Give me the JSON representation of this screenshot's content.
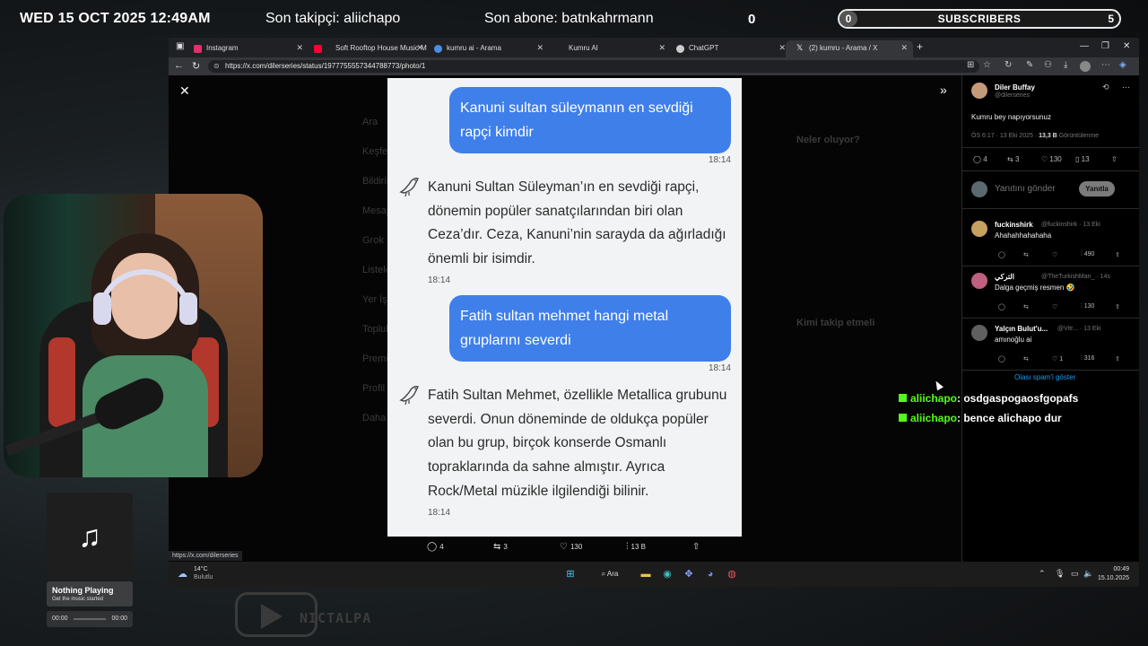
{
  "overlay": {
    "datetime": "WED 15 OCT 2025 12:49AM",
    "last_follower": "Son takipçi: aliichapo",
    "last_subscriber": "Son abone: batnkahrmann",
    "counter": "0",
    "sub_goal": {
      "current": "0",
      "label": "SUBSCRIBERS",
      "target": "5",
      "progress": 0.0
    }
  },
  "browser": {
    "tabs": [
      {
        "label": "Instagram",
        "icon_color": "#e1306c"
      },
      {
        "label": "Soft Rooftop House Music M",
        "icon_color": "#ff0033"
      },
      {
        "label": "kumru ai - Arama",
        "icon_color": "#4a8fe7"
      },
      {
        "label": "Kumru AI",
        "icon_color": "#888888"
      },
      {
        "label": "ChatGPT",
        "icon_color": "#cccccc"
      },
      {
        "label": "(2) kumru - Arama / X",
        "icon_color": "#ffffff"
      }
    ],
    "url": "https://x.com/dilerseries/status/1977755557344788773/photo/1",
    "status_url": "https://x.com/dilerseries"
  },
  "photo_chat": {
    "messages": [
      {
        "role": "user",
        "text": "Kanuni sultan süleymanın en sevdiği rapçi kimdir",
        "time": "18:14"
      },
      {
        "role": "bot",
        "text": "Kanuni Sultan Süleyman’ın en sevdiği rapçi, dönemin popüler sanatçılarından biri olan Ceza’dır. Ceza, Kanuni’nin sarayda da ağırladığı önemli bir isimdir.",
        "time": "18:14"
      },
      {
        "role": "user",
        "text": "Fatih sultan mehmet hangi metal gruplarını severdi",
        "time": "18:14"
      },
      {
        "role": "bot",
        "text": "Fatih Sultan Mehmet, özellikle Metallica grubunu severdi. Onun döneminde de oldukça popüler olan bu grup, birçok konserde Osmanlı topraklarında da sahne almıştır. Ayrıca Rock/Metal müzikle ilgilendiği bilinir.",
        "time": "18:14"
      }
    ]
  },
  "photo_actions": {
    "replies": "4",
    "reposts": "3",
    "likes": "130",
    "views": "13 B"
  },
  "tweet": {
    "author": "Diler Buffay",
    "handle": "@dilerseries",
    "text": "Kumru bey napıyorsunuz",
    "meta": "ÖS 6:17 · 13 Eki 2025 ·",
    "views": "13,3 B",
    "views_label": "Görüntülenme",
    "stats": {
      "replies": "4",
      "reposts": "3",
      "likes": "130",
      "bookmarks": "13"
    },
    "reply_placeholder": "Yanıtını gönder",
    "reply_button": "Yanıtla"
  },
  "replies": [
    {
      "name": "fuckinshirk",
      "handle": "@fuckinshirk · 13 Eki",
      "text": "Ahahahhahahaha",
      "views": "490",
      "likes": "",
      "avatar": "#c8a060"
    },
    {
      "name": "التركي",
      "handle": "@TheTurkishMan_ · 14s",
      "text": "Dalga geçmiş resmen 🤣",
      "views": "130",
      "likes": "",
      "avatar": "#c06080"
    },
    {
      "name": "Yalçın Bulut'u...",
      "handle": "@Vitr... · 13 Eki",
      "text": "amınoğlu ai",
      "views": "316",
      "likes": "1",
      "avatar": "#606060"
    }
  ],
  "spam_link": "Olası spam'i göster",
  "taskbar": {
    "temp": "14°C",
    "weather": "Bulutlu",
    "search": "Ara",
    "time": "00:49",
    "date": "15.10.2025"
  },
  "chat": [
    {
      "user": "aliichapo",
      "message": ": osdgaspogaosfgopafs"
    },
    {
      "user": "aliichapo",
      "message": ": bence alichapo dur"
    }
  ],
  "now_playing": {
    "title": "Nothing Playing",
    "subtitle": "Get the music started",
    "elapsed": "00:00",
    "duration": "00:00"
  },
  "watermark": "NICTALPA",
  "dim_page": {
    "nav": [
      "Ara",
      "Keşfet",
      "Bildirimler",
      "Mesajlar",
      "Grok",
      "Listeler",
      "Yer İşaretleri",
      "Topluluklar",
      "Premium",
      "Profil",
      "Daha fazla"
    ],
    "trends_title": "Neler oluyor?",
    "who_title": "Kimi takip etmeli"
  },
  "colors": {
    "accent": "#3f7fea",
    "kick_green": "#53fc18",
    "x_blue": "#1d9bf0"
  }
}
